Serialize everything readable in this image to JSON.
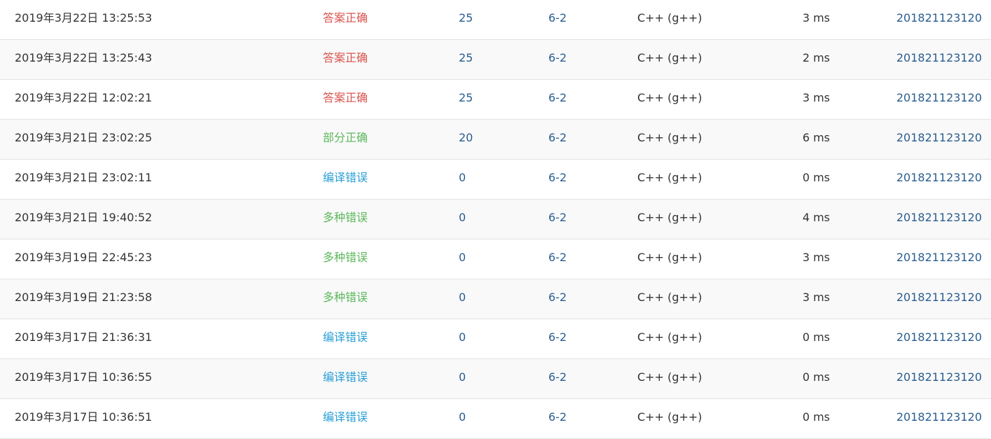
{
  "colors": {
    "accepted": "#d9534f",
    "partially_accepted": "#5cb85c",
    "multiple_errors": "#5cb85c",
    "compile_error": "#2a9fd6",
    "link": "#2a5d8f",
    "stripe": "#f9f9f9"
  },
  "main": {
    "submissions": [
      {
        "time": "2019年3月22日 13:25:53",
        "status": "答案正确",
        "status_key": "accepted",
        "score": "25",
        "problem": "6-2",
        "compiler": "C++ (g++)",
        "runtime": "3 ms",
        "user": "201821123120"
      },
      {
        "time": "2019年3月22日 13:25:43",
        "status": "答案正确",
        "status_key": "accepted",
        "score": "25",
        "problem": "6-2",
        "compiler": "C++ (g++)",
        "runtime": "2 ms",
        "user": "201821123120"
      },
      {
        "time": "2019年3月22日 12:02:21",
        "status": "答案正确",
        "status_key": "accepted",
        "score": "25",
        "problem": "6-2",
        "compiler": "C++ (g++)",
        "runtime": "3 ms",
        "user": "201821123120"
      },
      {
        "time": "2019年3月21日 23:02:25",
        "status": "部分正确",
        "status_key": "partially_accepted",
        "score": "20",
        "problem": "6-2",
        "compiler": "C++ (g++)",
        "runtime": "6 ms",
        "user": "201821123120"
      },
      {
        "time": "2019年3月21日 23:02:11",
        "status": "编译错误",
        "status_key": "compile_error",
        "score": "0",
        "problem": "6-2",
        "compiler": "C++ (g++)",
        "runtime": "0 ms",
        "user": "201821123120"
      },
      {
        "time": "2019年3月21日 19:40:52",
        "status": "多种错误",
        "status_key": "multiple_errors",
        "score": "0",
        "problem": "6-2",
        "compiler": "C++ (g++)",
        "runtime": "4 ms",
        "user": "201821123120"
      },
      {
        "time": "2019年3月19日 22:45:23",
        "status": "多种错误",
        "status_key": "multiple_errors",
        "score": "0",
        "problem": "6-2",
        "compiler": "C++ (g++)",
        "runtime": "3 ms",
        "user": "201821123120"
      },
      {
        "time": "2019年3月19日 21:23:58",
        "status": "多种错误",
        "status_key": "multiple_errors",
        "score": "0",
        "problem": "6-2",
        "compiler": "C++ (g++)",
        "runtime": "3 ms",
        "user": "201821123120"
      },
      {
        "time": "2019年3月17日 21:36:31",
        "status": "编译错误",
        "status_key": "compile_error",
        "score": "0",
        "problem": "6-2",
        "compiler": "C++ (g++)",
        "runtime": "0 ms",
        "user": "201821123120"
      },
      {
        "time": "2019年3月17日 10:36:55",
        "status": "编译错误",
        "status_key": "compile_error",
        "score": "0",
        "problem": "6-2",
        "compiler": "C++ (g++)",
        "runtime": "0 ms",
        "user": "201821123120"
      },
      {
        "time": "2019年3月17日 10:36:51",
        "status": "编译错误",
        "status_key": "compile_error",
        "score": "0",
        "problem": "6-2",
        "compiler": "C++ (g++)",
        "runtime": "0 ms",
        "user": "201821123120"
      }
    ]
  }
}
